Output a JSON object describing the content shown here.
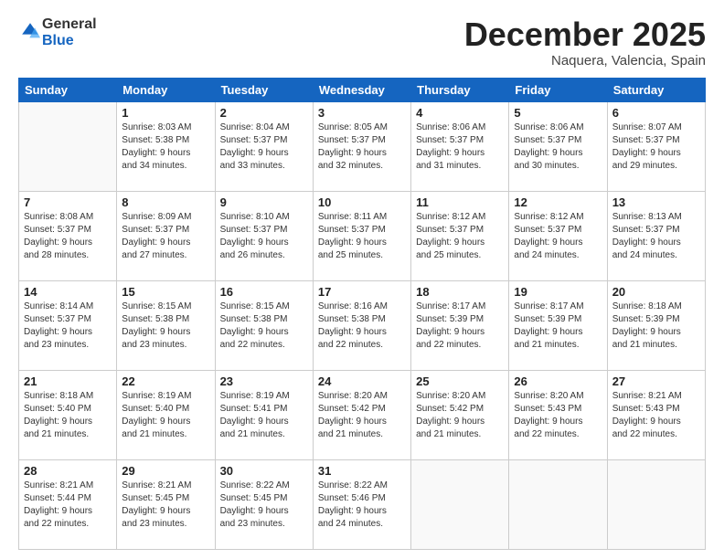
{
  "header": {
    "logo_general": "General",
    "logo_blue": "Blue",
    "month": "December 2025",
    "location": "Naquera, Valencia, Spain"
  },
  "days_of_week": [
    "Sunday",
    "Monday",
    "Tuesday",
    "Wednesday",
    "Thursday",
    "Friday",
    "Saturday"
  ],
  "weeks": [
    [
      {
        "day": "",
        "info": ""
      },
      {
        "day": "1",
        "info": "Sunrise: 8:03 AM\nSunset: 5:38 PM\nDaylight: 9 hours\nand 34 minutes."
      },
      {
        "day": "2",
        "info": "Sunrise: 8:04 AM\nSunset: 5:37 PM\nDaylight: 9 hours\nand 33 minutes."
      },
      {
        "day": "3",
        "info": "Sunrise: 8:05 AM\nSunset: 5:37 PM\nDaylight: 9 hours\nand 32 minutes."
      },
      {
        "day": "4",
        "info": "Sunrise: 8:06 AM\nSunset: 5:37 PM\nDaylight: 9 hours\nand 31 minutes."
      },
      {
        "day": "5",
        "info": "Sunrise: 8:06 AM\nSunset: 5:37 PM\nDaylight: 9 hours\nand 30 minutes."
      },
      {
        "day": "6",
        "info": "Sunrise: 8:07 AM\nSunset: 5:37 PM\nDaylight: 9 hours\nand 29 minutes."
      }
    ],
    [
      {
        "day": "7",
        "info": "Sunrise: 8:08 AM\nSunset: 5:37 PM\nDaylight: 9 hours\nand 28 minutes."
      },
      {
        "day": "8",
        "info": "Sunrise: 8:09 AM\nSunset: 5:37 PM\nDaylight: 9 hours\nand 27 minutes."
      },
      {
        "day": "9",
        "info": "Sunrise: 8:10 AM\nSunset: 5:37 PM\nDaylight: 9 hours\nand 26 minutes."
      },
      {
        "day": "10",
        "info": "Sunrise: 8:11 AM\nSunset: 5:37 PM\nDaylight: 9 hours\nand 25 minutes."
      },
      {
        "day": "11",
        "info": "Sunrise: 8:12 AM\nSunset: 5:37 PM\nDaylight: 9 hours\nand 25 minutes."
      },
      {
        "day": "12",
        "info": "Sunrise: 8:12 AM\nSunset: 5:37 PM\nDaylight: 9 hours\nand 24 minutes."
      },
      {
        "day": "13",
        "info": "Sunrise: 8:13 AM\nSunset: 5:37 PM\nDaylight: 9 hours\nand 24 minutes."
      }
    ],
    [
      {
        "day": "14",
        "info": "Sunrise: 8:14 AM\nSunset: 5:37 PM\nDaylight: 9 hours\nand 23 minutes."
      },
      {
        "day": "15",
        "info": "Sunrise: 8:15 AM\nSunset: 5:38 PM\nDaylight: 9 hours\nand 23 minutes."
      },
      {
        "day": "16",
        "info": "Sunrise: 8:15 AM\nSunset: 5:38 PM\nDaylight: 9 hours\nand 22 minutes."
      },
      {
        "day": "17",
        "info": "Sunrise: 8:16 AM\nSunset: 5:38 PM\nDaylight: 9 hours\nand 22 minutes."
      },
      {
        "day": "18",
        "info": "Sunrise: 8:17 AM\nSunset: 5:39 PM\nDaylight: 9 hours\nand 22 minutes."
      },
      {
        "day": "19",
        "info": "Sunrise: 8:17 AM\nSunset: 5:39 PM\nDaylight: 9 hours\nand 21 minutes."
      },
      {
        "day": "20",
        "info": "Sunrise: 8:18 AM\nSunset: 5:39 PM\nDaylight: 9 hours\nand 21 minutes."
      }
    ],
    [
      {
        "day": "21",
        "info": "Sunrise: 8:18 AM\nSunset: 5:40 PM\nDaylight: 9 hours\nand 21 minutes."
      },
      {
        "day": "22",
        "info": "Sunrise: 8:19 AM\nSunset: 5:40 PM\nDaylight: 9 hours\nand 21 minutes."
      },
      {
        "day": "23",
        "info": "Sunrise: 8:19 AM\nSunset: 5:41 PM\nDaylight: 9 hours\nand 21 minutes."
      },
      {
        "day": "24",
        "info": "Sunrise: 8:20 AM\nSunset: 5:42 PM\nDaylight: 9 hours\nand 21 minutes."
      },
      {
        "day": "25",
        "info": "Sunrise: 8:20 AM\nSunset: 5:42 PM\nDaylight: 9 hours\nand 21 minutes."
      },
      {
        "day": "26",
        "info": "Sunrise: 8:20 AM\nSunset: 5:43 PM\nDaylight: 9 hours\nand 22 minutes."
      },
      {
        "day": "27",
        "info": "Sunrise: 8:21 AM\nSunset: 5:43 PM\nDaylight: 9 hours\nand 22 minutes."
      }
    ],
    [
      {
        "day": "28",
        "info": "Sunrise: 8:21 AM\nSunset: 5:44 PM\nDaylight: 9 hours\nand 22 minutes."
      },
      {
        "day": "29",
        "info": "Sunrise: 8:21 AM\nSunset: 5:45 PM\nDaylight: 9 hours\nand 23 minutes."
      },
      {
        "day": "30",
        "info": "Sunrise: 8:22 AM\nSunset: 5:45 PM\nDaylight: 9 hours\nand 23 minutes."
      },
      {
        "day": "31",
        "info": "Sunrise: 8:22 AM\nSunset: 5:46 PM\nDaylight: 9 hours\nand 24 minutes."
      },
      {
        "day": "",
        "info": ""
      },
      {
        "day": "",
        "info": ""
      },
      {
        "day": "",
        "info": ""
      }
    ]
  ]
}
